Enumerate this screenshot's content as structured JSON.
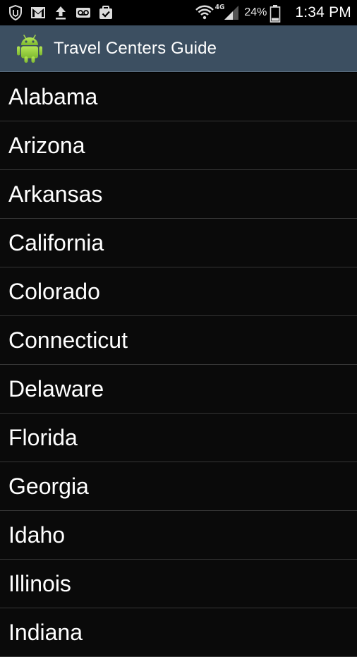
{
  "status_bar": {
    "network_label": "4G",
    "battery_percent": "24%",
    "time": "1:34 PM",
    "icons": [
      "shield-notification-icon",
      "gmail-icon",
      "upload-icon",
      "voicemail-icon",
      "task-icon",
      "wifi-icon",
      "signal-icon",
      "battery-icon"
    ]
  },
  "action_bar": {
    "title": "Travel Centers Guide",
    "app_icon": "android-icon",
    "accent_color": "#3c4f61"
  },
  "states": [
    "Alabama",
    "Arizona",
    "Arkansas",
    "California",
    "Colorado",
    "Connecticut",
    "Delaware",
    "Florida",
    "Georgia",
    "Idaho",
    "Illinois",
    "Indiana"
  ]
}
